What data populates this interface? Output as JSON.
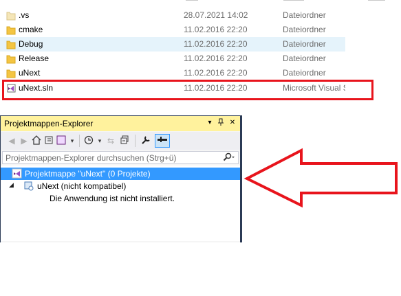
{
  "files": [
    {
      "name": ".vs",
      "date": "28.07.2021 14:02",
      "type": "Dateiordner",
      "icon": "folder-hidden-icon"
    },
    {
      "name": "cmake",
      "date": "11.02.2016 22:20",
      "type": "Dateiordner",
      "icon": "folder-icon"
    },
    {
      "name": "Debug",
      "date": "11.02.2016 22:20",
      "type": "Dateiordner",
      "icon": "folder-icon"
    },
    {
      "name": "Release",
      "date": "11.02.2016 22:20",
      "type": "Dateiordner",
      "icon": "folder-icon"
    },
    {
      "name": "uNext",
      "date": "11.02.2016 22:20",
      "type": "Dateiordner",
      "icon": "folder-icon"
    },
    {
      "name": "uNext.sln",
      "date": "11.02.2016 22:20",
      "type": "Microsoft Visual S",
      "icon": "visual-studio-solution-icon"
    }
  ],
  "solution_explorer": {
    "title": "Projektmappen-Explorer",
    "search_placeholder": "Projektmappen-Explorer durchsuchen (Strg+ü)",
    "tree": [
      {
        "label": "Projektmappe \"uNext\" (0 Projekte)",
        "selected": true
      },
      {
        "label": "uNext (nicht kompatibel)"
      },
      {
        "label": "Die Anwendung ist nicht installiert."
      }
    ]
  },
  "colors": {
    "highlight_red": "#e8141c",
    "title_bar": "#fff29d",
    "selection": "#3399ff",
    "folder": "#f4c542"
  }
}
